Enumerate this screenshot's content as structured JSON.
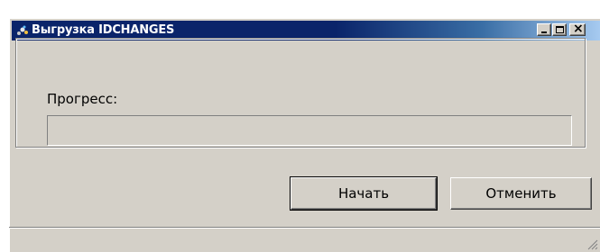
{
  "window": {
    "title": "Выгрузка IDCHANGES",
    "icon": "app-icon"
  },
  "titlebar_buttons": {
    "minimize_icon": "minimize-icon",
    "maximize_icon": "maximize-icon",
    "close_icon": "close-icon",
    "close_glyph": "×"
  },
  "main": {
    "progress_label": "Прогресс:",
    "progress_fraction": 0
  },
  "buttons": {
    "start_label": "Начать",
    "cancel_label": "Отменить"
  },
  "colors": {
    "face": "#d4d0c8",
    "title_active": "#0a246a",
    "title_gradient_end": "#a6caf0"
  }
}
